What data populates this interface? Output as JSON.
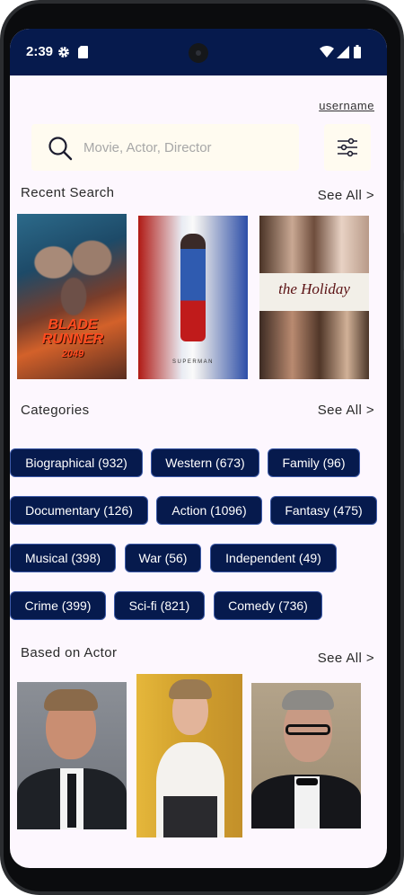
{
  "status_bar": {
    "time": "2:39",
    "icons": [
      "gear-icon",
      "sd-card-icon",
      "wifi-icon",
      "signal-icon",
      "battery-icon"
    ],
    "background": "#061a4d"
  },
  "header": {
    "username": "username"
  },
  "search": {
    "placeholder": "Movie, Actor, Director",
    "value": "",
    "icon": "search-icon",
    "filter_icon": "filter-sliders-icon"
  },
  "recent_search": {
    "title": "Recent Search",
    "see_all": "See All >",
    "posters": [
      {
        "name": "blade-runner-2049-poster",
        "title_line1": "BLADE",
        "title_line2": "RUNNER",
        "title_line3": "2049"
      },
      {
        "name": "superman-poster",
        "title": "SUPERMAN"
      },
      {
        "name": "the-holiday-poster",
        "title": "the Holiday"
      }
    ]
  },
  "categories": {
    "title": "Categories",
    "see_all": "See All >",
    "chip_color": "#061a4d",
    "items": [
      "Biographical (932)",
      "Western (673)",
      "Family (96)",
      "Documentary (126)",
      "Action (1096)",
      "Fantasy (475)",
      "Musical (398)",
      "War (56)",
      "Independent (49)",
      "Crime (399)",
      "Sci-fi (821)",
      "Comedy (736)"
    ]
  },
  "based_on_actor": {
    "title": "Based on Actor",
    "see_all": "See All >",
    "actors": [
      "actor-photo-1",
      "actor-photo-2",
      "actor-photo-3"
    ]
  }
}
